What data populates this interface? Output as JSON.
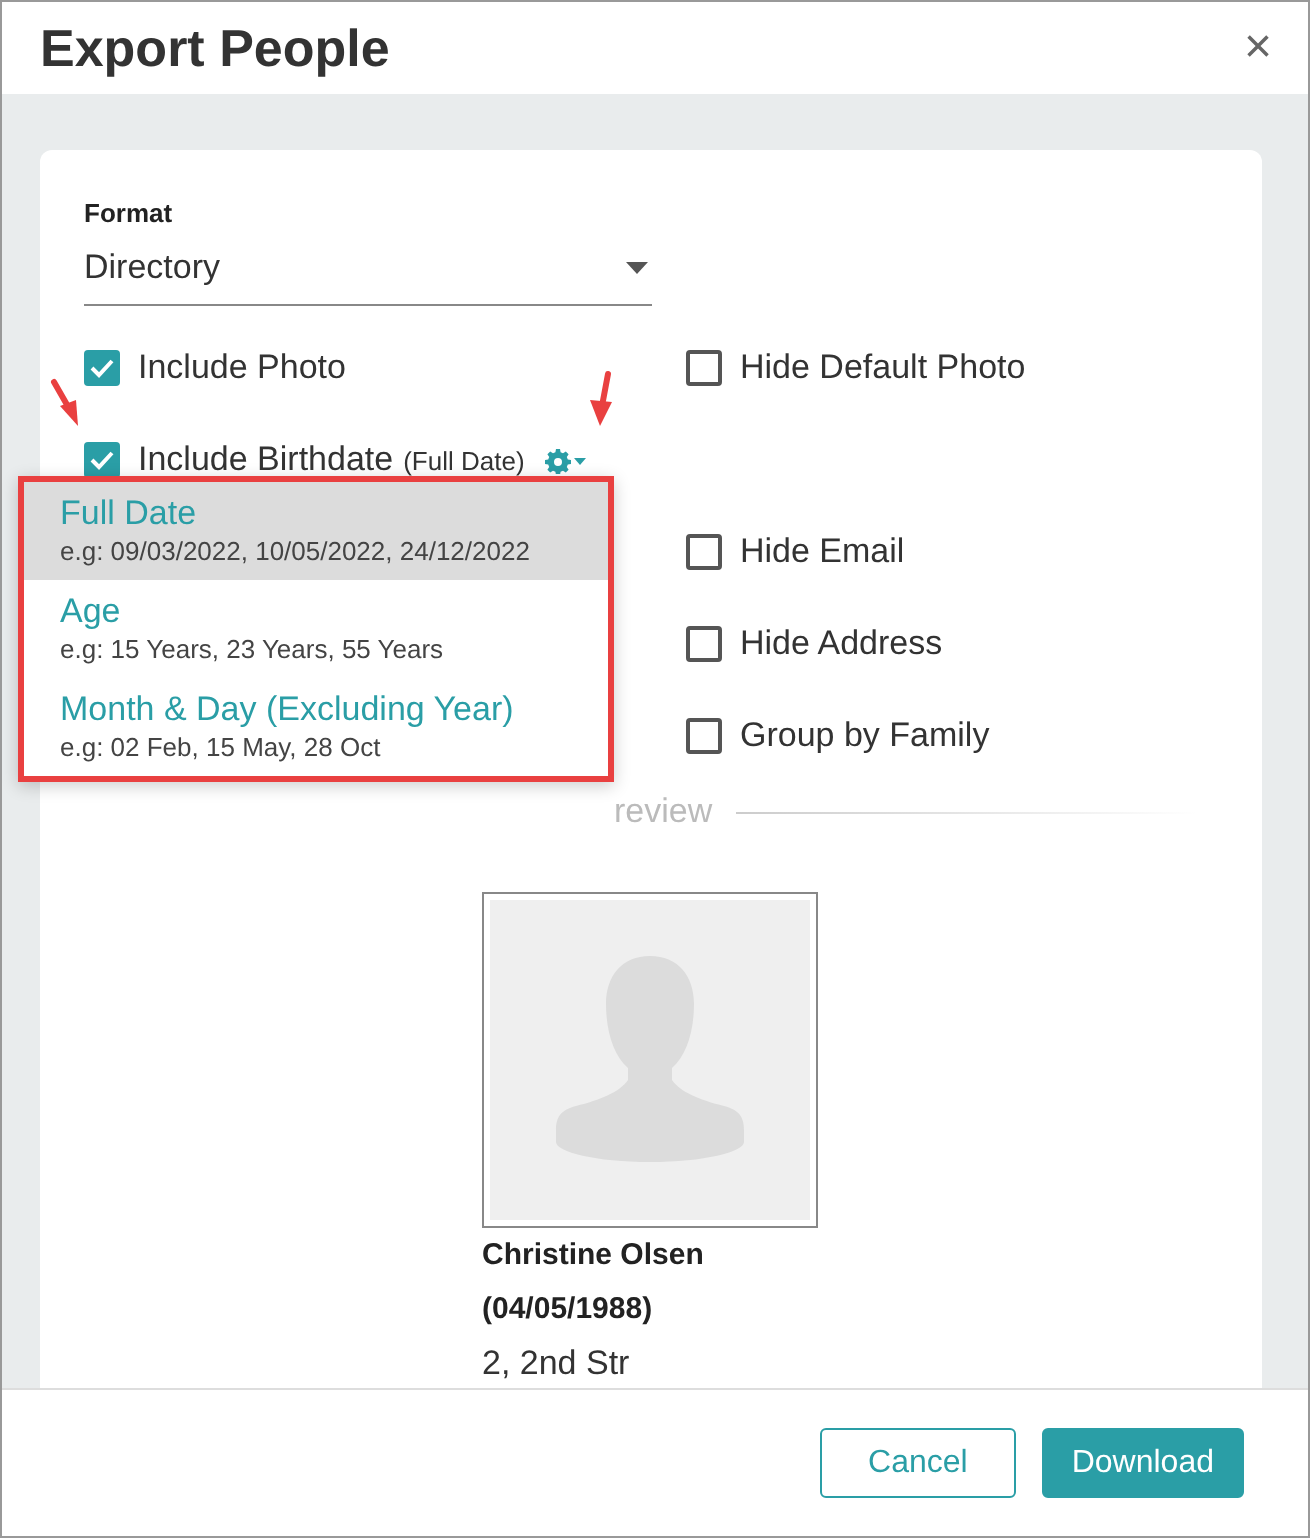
{
  "dialog": {
    "title": "Export People",
    "close": "×"
  },
  "format": {
    "label": "Format",
    "value": "Directory"
  },
  "option_rows": [
    {
      "left": {
        "label": "Include Photo",
        "checked": true
      },
      "right": {
        "label": "Hide Default Photo",
        "checked": false
      }
    },
    {
      "left": {
        "label": "Include Birthdate",
        "note": "(Full Date)",
        "checked": true,
        "has_settings": true
      }
    },
    {
      "right": {
        "label": "Hide Email",
        "checked": false
      }
    },
    {
      "right": {
        "label": "Hide Address",
        "checked": false
      }
    },
    {
      "right": {
        "label": "Group by Family",
        "checked": false
      }
    }
  ],
  "birthdate_menu": {
    "items": [
      {
        "title": "Full Date",
        "example": "e.g: 09/03/2022, 10/05/2022, 24/12/2022",
        "selected": true
      },
      {
        "title": "Age",
        "example": "e.g: 15 Years, 23 Years, 55 Years",
        "selected": false
      },
      {
        "title": "Month & Day (Excluding Year)",
        "example": "e.g: 02 Feb, 15 May, 28 Oct",
        "selected": false
      }
    ]
  },
  "preview": {
    "heading": "review",
    "name": "Christine Olsen",
    "birthdate": "(04/05/1988)",
    "address": "2, 2nd Str"
  },
  "buttons": [
    {
      "label": "Cancel",
      "kind": "secondary"
    },
    {
      "label": "Download",
      "kind": "primary"
    }
  ]
}
